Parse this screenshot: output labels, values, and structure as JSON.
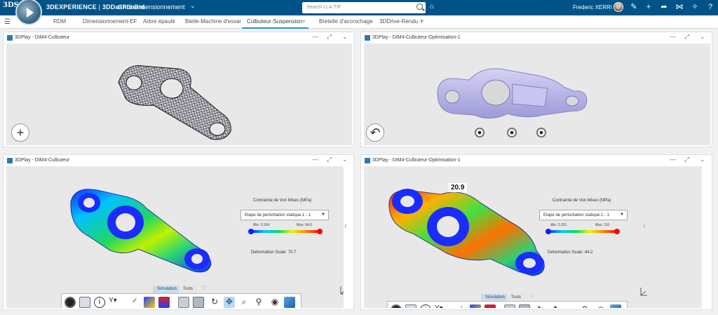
{
  "topbar": {
    "logo": "3DS",
    "brand_bold": "3DEXPERIENCE",
    "brand_sep": " | ",
    "brand_app": "3DDashboard",
    "dashboard": "CPI2-Dimensionnement",
    "search_placeholder": "Search LLA-TIF",
    "user": "Frederic XERRI",
    "icons": [
      "tag-icon",
      "add-icon",
      "share-icon",
      "network-icon",
      "compass-tool-icon",
      "help-icon"
    ]
  },
  "tabs": [
    {
      "label": "RDM"
    },
    {
      "label": "Dimensionnement-EF"
    },
    {
      "label": "Arbre épaulé"
    },
    {
      "label": "Bielle-Machine d'essai"
    },
    {
      "label": "Culbuteur-Suspension",
      "active": true
    },
    {
      "label": "Bretelle d'accrochage"
    },
    {
      "label": "3DDrive-Rendu"
    }
  ],
  "panels": {
    "top_left": {
      "title": "3DPlay - DIM4-Culbuteur"
    },
    "top_right": {
      "title": "3DPlay - DIM4-Culbuteur-Optimisation-1"
    },
    "bottom_left": {
      "title": "3DPlay - DIM4-Culbuteur",
      "legend_title": "Contrainte de Von Mises (MPa)",
      "step": "Etape de perturbation statique.1 - 1",
      "min": "Min: 0.164",
      "max": "Max: 94.6",
      "deformation": "Deformation Scale: 70.7",
      "tab_sim": "Simulation",
      "tab_tools": "Tools"
    },
    "bottom_right": {
      "title": "3DPlay - DIM4-Culbuteur-Optimisation-1",
      "legend_title": "Contrainte de Von Mises (MPa)",
      "step": "Etape de perturbation statique.1 - 1",
      "min": "Min: 0.151",
      "max": "Max: 116",
      "deformation": "Deformation Scale: 44.2",
      "probe_value": "20.9",
      "tab_sim": "Simulation",
      "tab_tools": "Tools"
    }
  },
  "colors": {
    "topbar": "#005386",
    "accent": "#368ec4",
    "mesh_part": "#b8b6ec",
    "legend_min": "#1020ff",
    "legend_max": "#ff0000"
  }
}
